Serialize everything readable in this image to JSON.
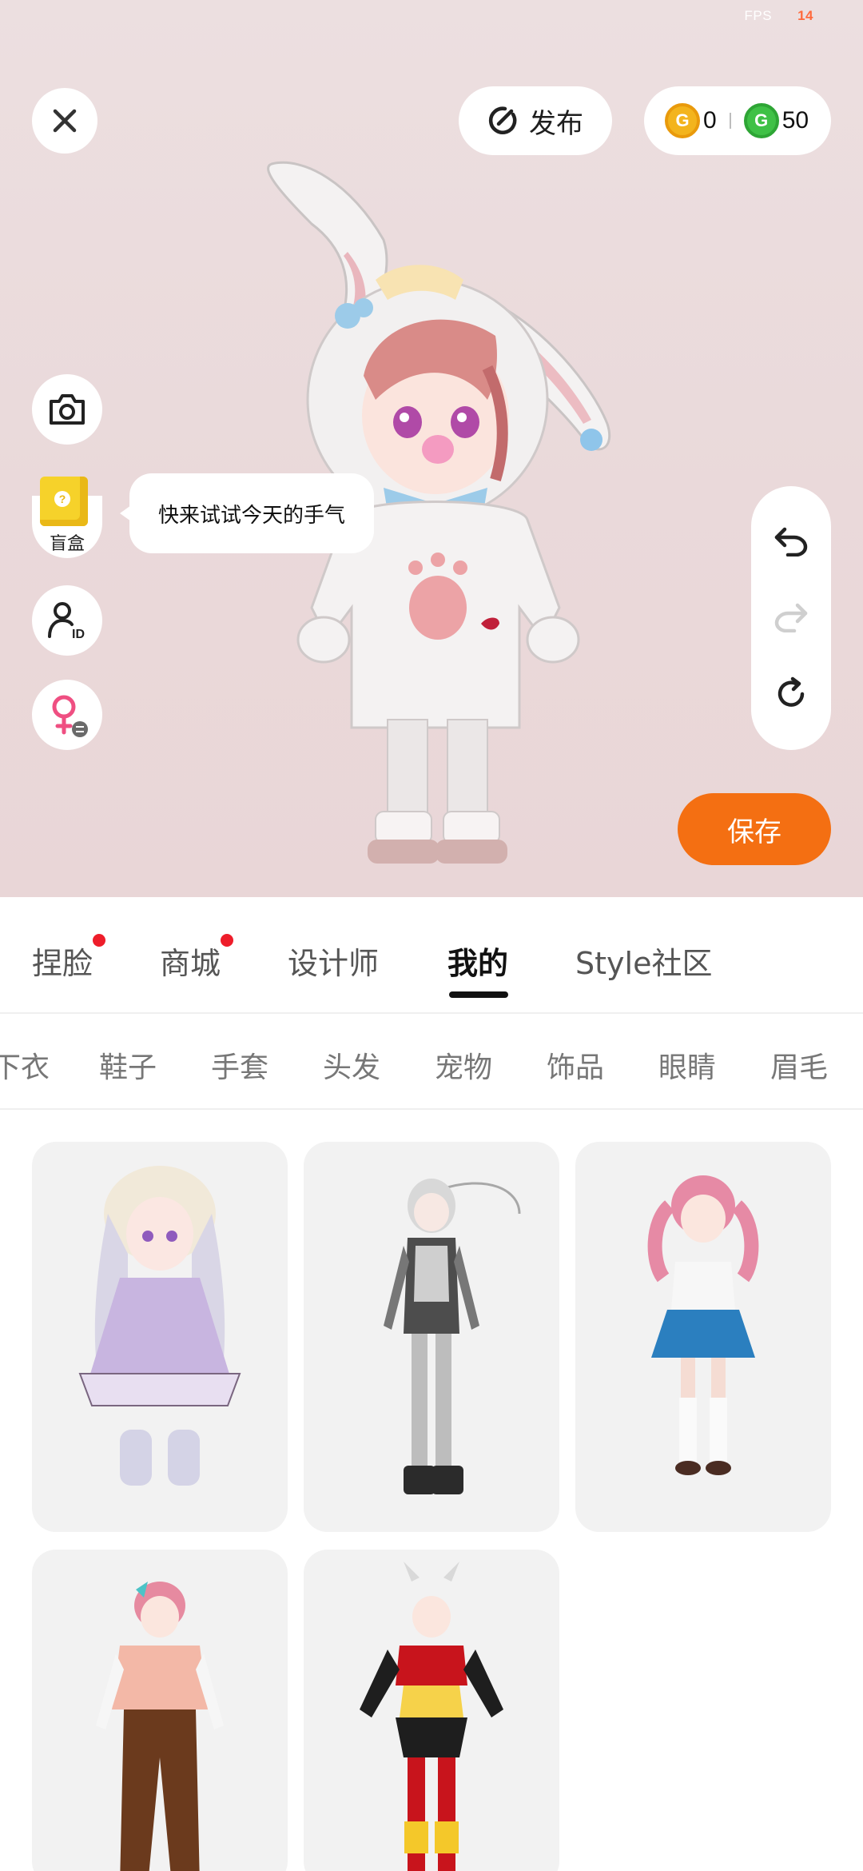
{
  "status": {
    "fps_label": "FPS",
    "fps_value": "14"
  },
  "header": {
    "close_icon": "close-icon",
    "publish_label": "发布",
    "gold_coins": "0",
    "green_coins": "50"
  },
  "side_tools": {
    "blind_box_label": "盲盒",
    "tip_text": "快来试试今天的手气"
  },
  "save_label": "保存",
  "tabs": [
    {
      "label": "捏脸",
      "badge": true
    },
    {
      "label": "商城",
      "badge": true
    },
    {
      "label": "设计师",
      "badge": false
    },
    {
      "label": "我的",
      "badge": false,
      "active": true
    },
    {
      "label": "Style社区",
      "badge": false
    }
  ],
  "subtabs": [
    "下衣",
    "鞋子",
    "手套",
    "头发",
    "宠物",
    "饰品",
    "眼睛",
    "眉毛"
  ],
  "outfits": [
    {
      "icon": "avatar-lavender-dress"
    },
    {
      "icon": "avatar-gray-tech"
    },
    {
      "icon": "avatar-pink-twintail-school"
    },
    {
      "icon": "avatar-pink-jacket-brown-pants"
    },
    {
      "icon": "avatar-red-horned-armor"
    }
  ],
  "colors": {
    "accent": "#f46f12",
    "badge": "#ee1d2a",
    "gold": "#f3b41d",
    "green": "#3fc146"
  }
}
